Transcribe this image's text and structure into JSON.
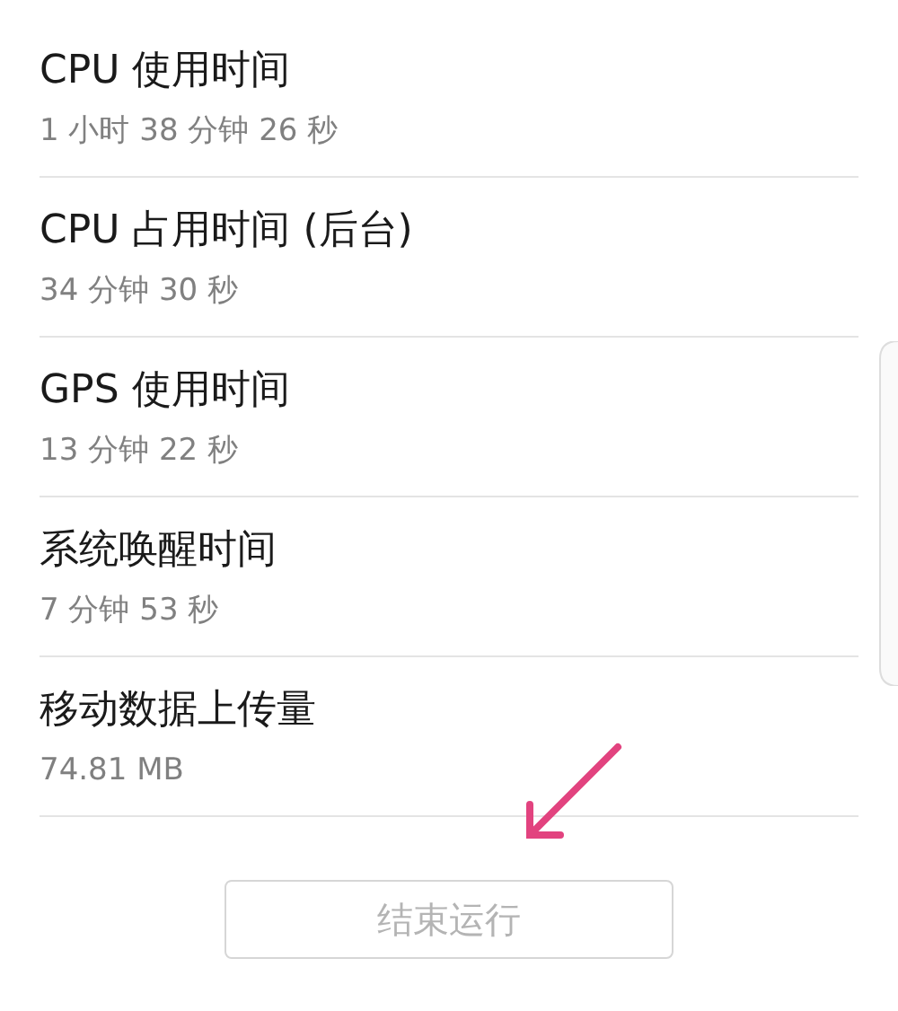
{
  "items": [
    {
      "title": "CPU 使用时间",
      "value": "1 小时 38 分钟 26 秒"
    },
    {
      "title": "CPU 占用时间 (后台)",
      "value": "34 分钟 30 秒"
    },
    {
      "title": "GPS 使用时间",
      "value": "13 分钟 22 秒"
    },
    {
      "title": "系统唤醒时间",
      "value": "7 分钟 53 秒"
    },
    {
      "title": "移动数据上传量",
      "value": "74.81 MB"
    }
  ],
  "button": {
    "label": "结束运行",
    "disabled": true
  }
}
